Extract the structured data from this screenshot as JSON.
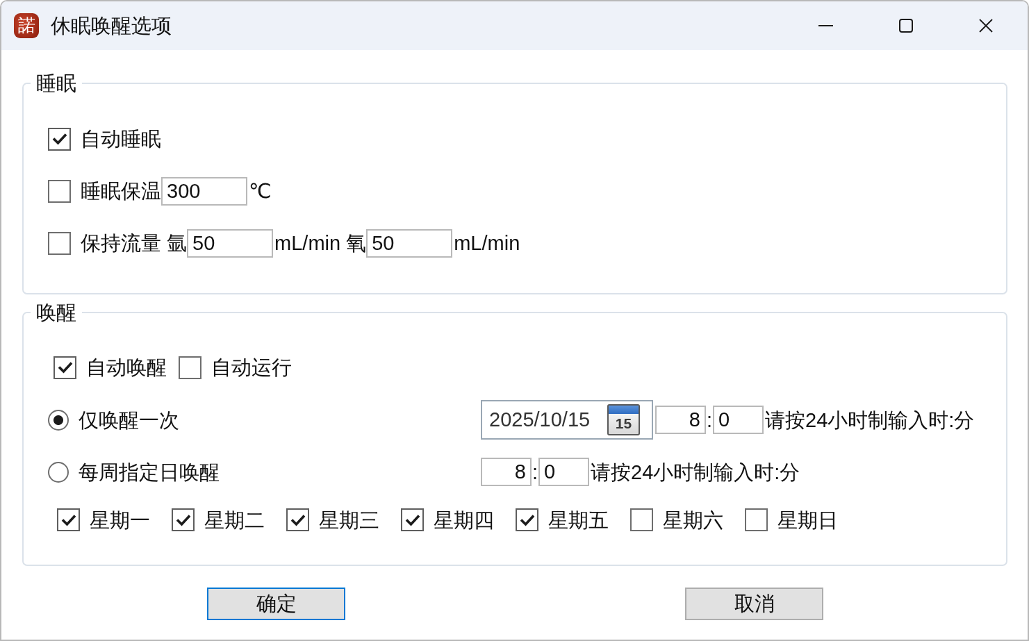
{
  "window": {
    "title": "休眠唤醒选项",
    "logo": "諾"
  },
  "sleep": {
    "title": "睡眠",
    "options": [
      {
        "label": "自动睡眠",
        "checked": true
      },
      {
        "label": "睡眠保温",
        "checked": false,
        "parts": [
          {
            "kind": "field",
            "value": "300"
          },
          {
            "kind": "unit",
            "text": "℃"
          }
        ]
      },
      {
        "label": "保持流量 氩",
        "checked": false,
        "parts": [
          {
            "kind": "field",
            "value": "50"
          },
          {
            "kind": "unit",
            "text": "mL/min 氧"
          },
          {
            "kind": "field",
            "value": "50"
          },
          {
            "kind": "unit",
            "text": "mL/min"
          }
        ]
      }
    ]
  },
  "wake": {
    "title": "唤醒",
    "toggles": [
      {
        "label": "自动唤醒",
        "checked": true
      },
      {
        "label": "自动运行",
        "checked": false
      }
    ],
    "modes": [
      {
        "label": "仅唤醒一次",
        "selected": true,
        "date": "2025/10/15",
        "calendar_day": "15",
        "hour": "8",
        "separator": ":",
        "minute": "0",
        "hint": "请按24小时制输入时:分"
      },
      {
        "label": "每周指定日唤醒",
        "selected": false,
        "hour": "8",
        "separator": ":",
        "minute": "0",
        "hint": "请按24小时制输入时:分"
      }
    ],
    "weekdays": [
      {
        "label": "星期一",
        "checked": true
      },
      {
        "label": "星期二",
        "checked": true
      },
      {
        "label": "星期三",
        "checked": true
      },
      {
        "label": "星期四",
        "checked": true
      },
      {
        "label": "星期五",
        "checked": true
      },
      {
        "label": "星期六",
        "checked": false
      },
      {
        "label": "星期日",
        "checked": false
      }
    ]
  },
  "buttons": [
    {
      "label": "确定",
      "default": true
    },
    {
      "label": "取消",
      "default": false
    }
  ]
}
